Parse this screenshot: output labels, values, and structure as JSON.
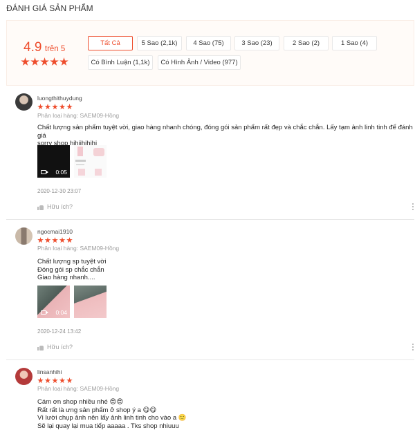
{
  "title": "ĐÁNH GIÁ SẢN PHẨM",
  "rating": {
    "score": "4.9",
    "out_of": "trên 5",
    "stars": 5,
    "star_color": "#ee4d2d"
  },
  "filters": {
    "all": "Tất Cả",
    "five": "5 Sao (2,1k)",
    "four": "4 Sao (75)",
    "three": "3 Sao (23)",
    "two": "2 Sao (2)",
    "one": "1 Sao (4)",
    "with_comment": "Có Bình Luận (1,1k)",
    "with_media": "Có Hình Ảnh / Video (977)"
  },
  "reviews": [
    {
      "username": "luongthithuydung",
      "stars": 5,
      "variant": "Phân loại hàng: SAEM09-Hồng",
      "lines": [
        "Chất lượng sản phẩm tuyệt vời, giao hàng nhanh chóng, đóng gói sản phẩm rất đẹp và chắc chắn. Lấy tạm ảnh linh tinh để đánh giá",
        "sorry shop hihiihihihi"
      ],
      "video_duration": "0:05",
      "time": "2020-12-30 23:07",
      "helpful": "Hữu ích?"
    },
    {
      "username": "ngocmai1910",
      "stars": 5,
      "variant": "Phân loại hàng: SAEM09-Hồng",
      "lines": [
        "Chất lượng sp tuyệt vời",
        "Đóng gói sp chắc chắn",
        "Giao hàng nhanh...."
      ],
      "video_duration": "0:04",
      "time": "2020-12-24 13:42",
      "helpful": "Hữu ích?"
    },
    {
      "username": "linsanhihi",
      "stars": 5,
      "variant": "Phân loại hàng: SAEM09-Hồng",
      "lines": [
        "Cám ơn shop nhiều nhé 😍😍",
        "Rất rất là ưng sản phẩm ở shop ý a 😋😋",
        "Vì lười chụp ảnh nên lấy ảnh linh tinh cho vào a 🙂",
        "Sẽ lại quay lại mua tiếp aaaaa . Tks shop nhiuuu"
      ]
    }
  ]
}
